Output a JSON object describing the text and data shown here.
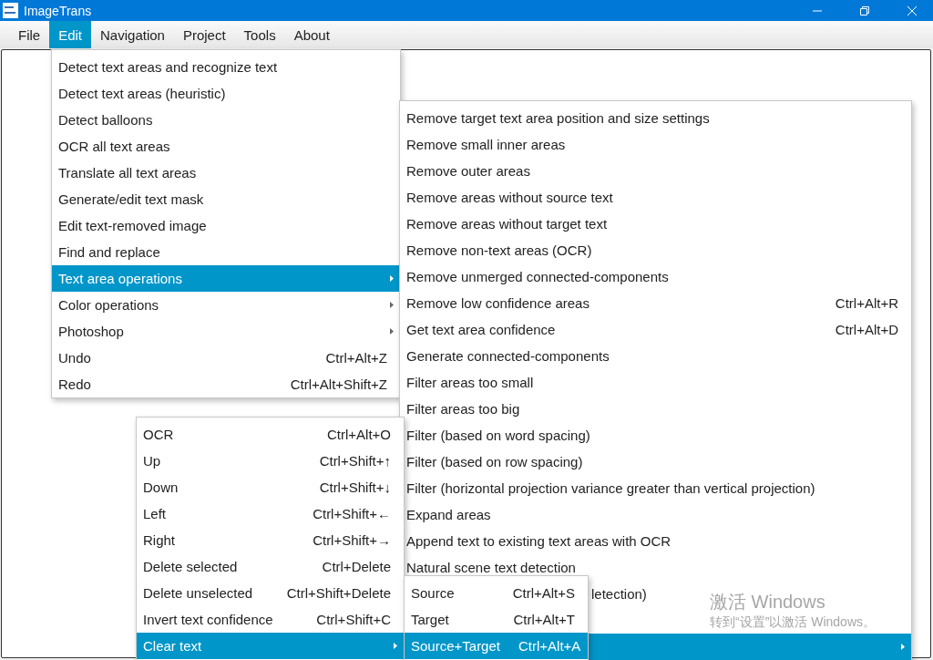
{
  "window": {
    "title": "ImageTrans"
  },
  "menu_bar": [
    {
      "label": "File",
      "selected": false
    },
    {
      "label": "Edit",
      "selected": true
    },
    {
      "label": "Navigation",
      "selected": false
    },
    {
      "label": "Project",
      "selected": false
    },
    {
      "label": "Tools",
      "selected": false
    },
    {
      "label": "About",
      "selected": false
    }
  ],
  "menus": [
    {
      "items": [
        {
          "label": "Detect text areas and recognize text",
          "selected": false
        },
        {
          "label": "Detect text areas (heuristic)",
          "selected": false
        },
        {
          "label": "Detect balloons",
          "selected": false
        },
        {
          "label": "OCR all text areas",
          "selected": false
        },
        {
          "label": "Translate all text areas",
          "selected": false
        },
        {
          "label": "Generate/edit text mask",
          "selected": false
        },
        {
          "label": "Edit text-removed image",
          "selected": false
        },
        {
          "label": "Find and replace",
          "selected": false
        },
        {
          "label": "Text area operations",
          "selected": true,
          "submenu": true
        },
        {
          "label": "Color operations",
          "selected": false,
          "submenu": true
        },
        {
          "label": "Photoshop",
          "selected": false,
          "submenu": true
        },
        {
          "label": "Undo",
          "shortcut": "Ctrl+Alt+Z",
          "selected": false
        },
        {
          "label": "Redo",
          "shortcut": "Ctrl+Alt+Shift+Z",
          "selected": false
        }
      ]
    },
    {
      "items": [
        {
          "label": "Remove target text area position and size settings",
          "selected": false
        },
        {
          "label": "Remove small inner areas",
          "selected": false
        },
        {
          "label": "Remove outer areas",
          "selected": false
        },
        {
          "label": "Remove areas without source text",
          "selected": false
        },
        {
          "label": "Remove areas without target text",
          "selected": false
        },
        {
          "label": "Remove non-text areas (OCR)",
          "selected": false
        },
        {
          "label": "Remove unmerged connected-components",
          "selected": false
        },
        {
          "label": "Remove low confidence areas",
          "shortcut": "Ctrl+Alt+R",
          "selected": false
        },
        {
          "label": "Get text area confidence",
          "shortcut": "Ctrl+Alt+D",
          "selected": false
        },
        {
          "label": "Generate connected-components",
          "selected": false
        },
        {
          "label": "Filter areas too small",
          "selected": false
        },
        {
          "label": "Filter areas too big",
          "selected": false
        },
        {
          "label": "Filter (based on word spacing)",
          "selected": false
        },
        {
          "label": "Filter (based on row spacing)",
          "selected": false
        },
        {
          "label": "Filter (horizontal projection variance greater than vertical projection)",
          "selected": false
        },
        {
          "label": "Expand areas",
          "selected": false
        },
        {
          "label": "Append text to existing text areas with OCR",
          "selected": false
        },
        {
          "label": "Natural scene text detection",
          "selected": false
        },
        {
          "label": "letection)",
          "selected": false
        },
        {
          "selected": false
        },
        {
          "selected": true,
          "submenu": true
        }
      ]
    },
    {
      "items": [
        {
          "label": "OCR",
          "shortcut": "Ctrl+Alt+O",
          "selected": false
        },
        {
          "label": "Up",
          "shortcut": "Ctrl+Shift+↑",
          "selected": false
        },
        {
          "label": "Down",
          "shortcut": "Ctrl+Shift+↓",
          "selected": false
        },
        {
          "label": "Left",
          "shortcut": "Ctrl+Shift+←",
          "selected": false
        },
        {
          "label": "Right",
          "shortcut": "Ctrl+Shift+→",
          "selected": false
        },
        {
          "label": "Delete selected",
          "shortcut": "Ctrl+Delete",
          "selected": false
        },
        {
          "label": "Delete unselected",
          "shortcut": "Ctrl+Shift+Delete",
          "selected": false
        },
        {
          "label": "Invert text confidence",
          "shortcut": "Ctrl+Shift+C",
          "selected": false
        },
        {
          "label": "Clear text",
          "selected": true,
          "submenu": true
        }
      ]
    },
    {
      "items": [
        {
          "label": "Source",
          "shortcut": "Ctrl+Alt+S",
          "selected": false
        },
        {
          "label": "Target",
          "shortcut": "Ctrl+Alt+T",
          "selected": false
        },
        {
          "label": "Source+Target",
          "shortcut": "Ctrl+Alt+A",
          "selected": true
        }
      ]
    }
  ],
  "activation_notice": {
    "title": "激活 Windows",
    "text": "转到“设置”以激活 Windows。"
  }
}
